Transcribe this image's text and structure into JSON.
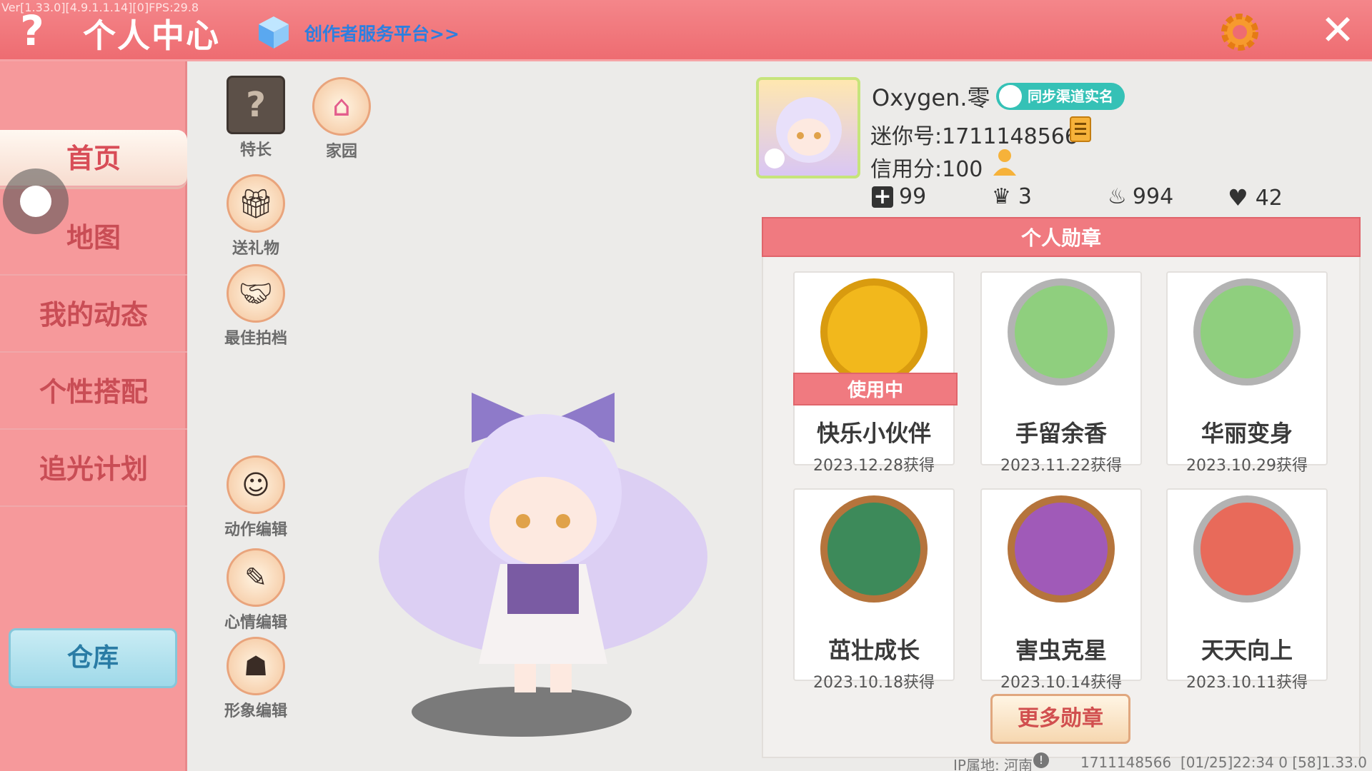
{
  "topbar": {
    "version": "Ver[1.33.0][4.9.1.1.14][0]FPS:29.8",
    "title": "个人中心",
    "creator_link": "创作者服务平台>>",
    "help_label": "?",
    "close_label": "✕"
  },
  "sidebar": {
    "items": [
      {
        "label": "首页"
      },
      {
        "label": "地图"
      },
      {
        "label": "我的动态"
      },
      {
        "label": "个性搭配"
      },
      {
        "label": "追光计划"
      }
    ],
    "warehouse_label": "仓库"
  },
  "functions": [
    {
      "label": "特长"
    },
    {
      "label": "家园"
    },
    {
      "label": "送礼物"
    },
    {
      "label": "最佳拍档"
    },
    {
      "label": "动作编辑"
    },
    {
      "label": "心情编辑"
    },
    {
      "label": "形象编辑"
    }
  ],
  "profile": {
    "name": "Oxygen.零",
    "sync_badge": "同步渠道实名",
    "mini_id": "迷你号:1711148566",
    "credit": "信用分:100",
    "stats": [
      {
        "icon": "plus-box-icon",
        "value": "99"
      },
      {
        "icon": "trophy-icon",
        "value": "3"
      },
      {
        "icon": "flame-icon",
        "value": "994"
      },
      {
        "icon": "heart-icon",
        "value": "42"
      }
    ]
  },
  "medals": {
    "header": "个人勋章",
    "in_use_label": "使用中",
    "items": [
      {
        "name": "快乐小伙伴",
        "date": "2023.12.28获得",
        "color": "#f2b81c"
      },
      {
        "name": "手留余香",
        "date": "2023.11.22获得",
        "color": "#8ccf72"
      },
      {
        "name": "华丽变身",
        "date": "2023.10.29获得",
        "color": "#8ccf72"
      },
      {
        "name": "茁壮成长",
        "date": "2023.10.18获得",
        "color": "#c27a3b"
      },
      {
        "name": "害虫克星",
        "date": "2023.10.14获得",
        "color": "#c27a3b"
      },
      {
        "name": "天天向上",
        "date": "2023.10.11获得",
        "color": "#b8b8b8"
      }
    ],
    "more_label": "更多勋章"
  },
  "footer": {
    "ip": "IP属地: 河南",
    "id": "1711148566",
    "time": "[01/25]22:34 0  [58]1.33.0"
  }
}
